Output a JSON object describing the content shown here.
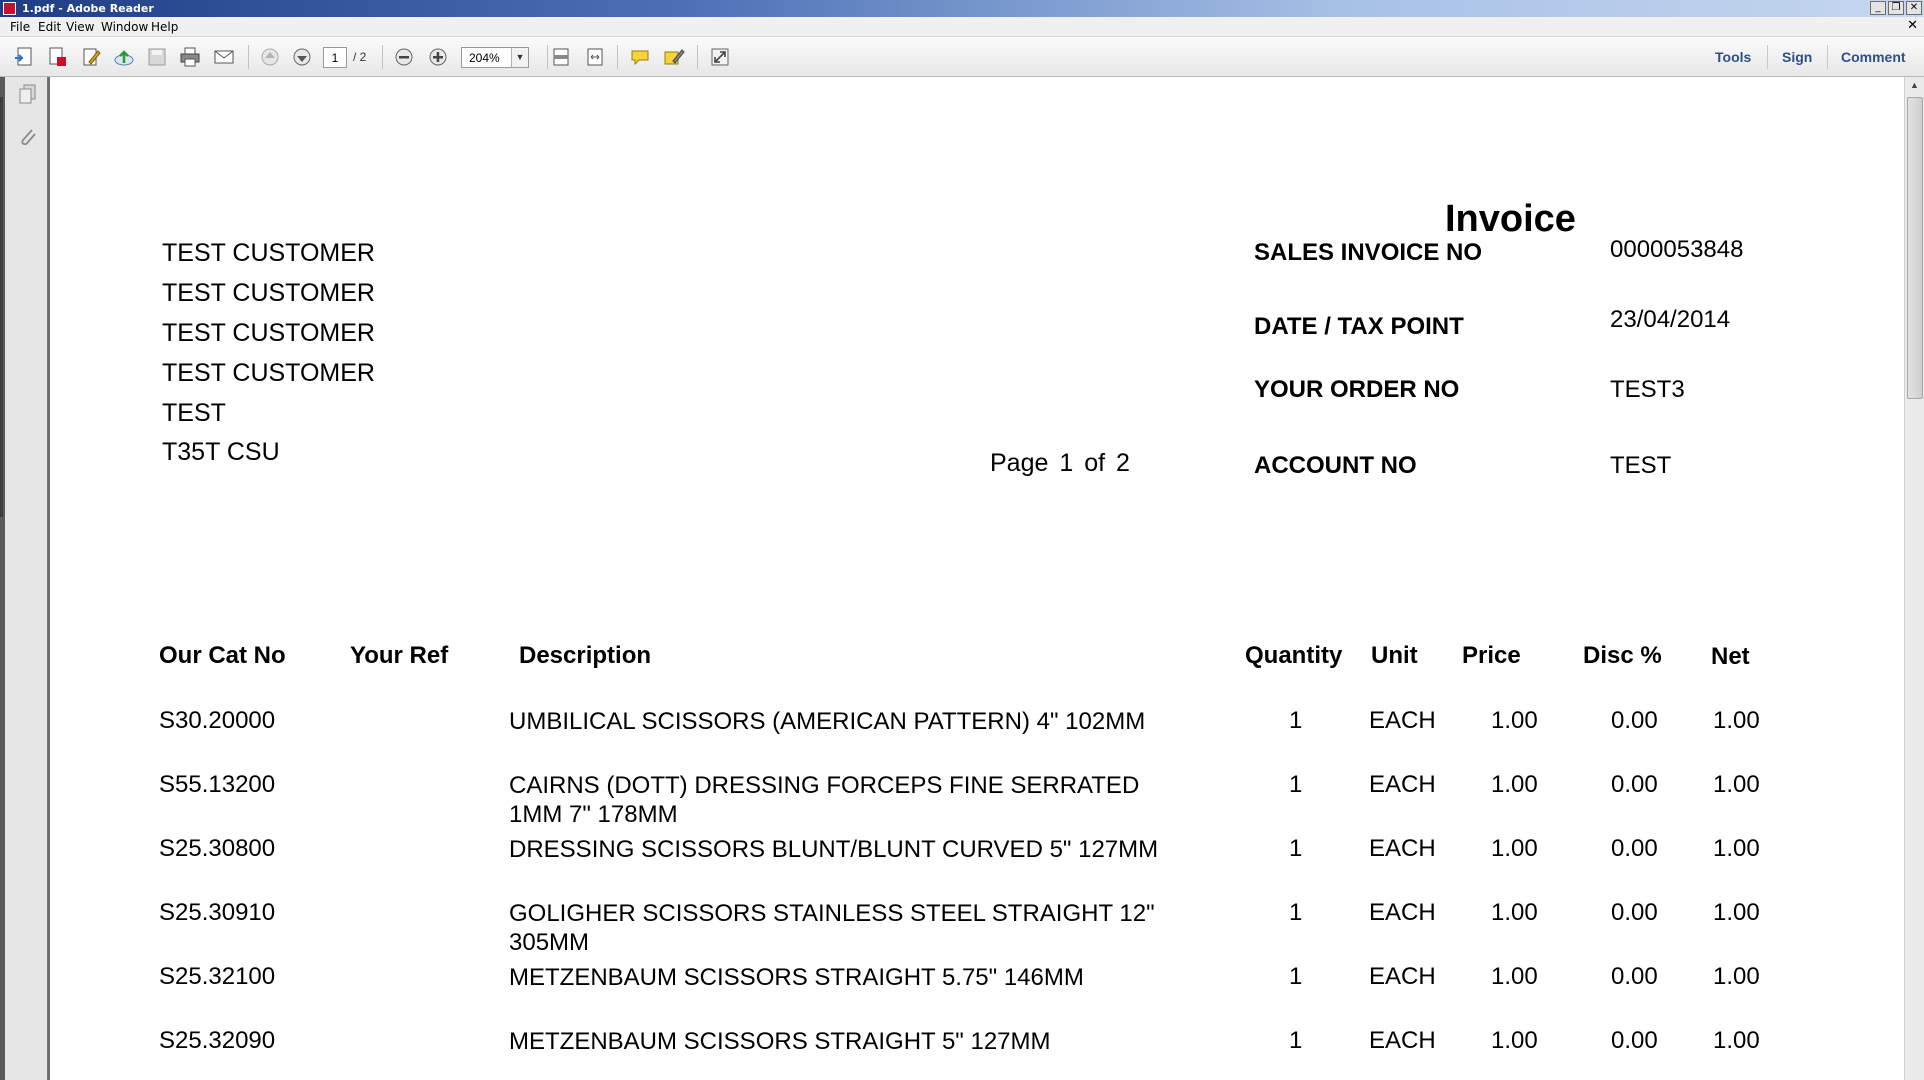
{
  "window": {
    "title": "1.pdf - Adobe Reader",
    "controls": {
      "minimize": "_",
      "restore": "❐",
      "close": "✕"
    },
    "doc_close": "✕"
  },
  "menu": [
    "File",
    "Edit",
    "View",
    "Window",
    "Help"
  ],
  "toolbar": {
    "icons": [
      "create-pdf-icon",
      "export-pdf-icon",
      "edit-pdf-icon",
      "upload-cloud-icon",
      "save-icon",
      "print-icon",
      "email-icon",
      "previous-page-icon",
      "next-page-icon",
      "zoom-out-icon",
      "zoom-in-icon",
      "fit-page-icon",
      "fit-width-icon",
      "comment-icon",
      "highlight-icon",
      "full-screen-icon"
    ],
    "page_current": "1",
    "page_total": "/ 2",
    "zoom": "204%",
    "zoom_dropdown": "▼",
    "tools": "Tools",
    "sign": "Sign",
    "comment": "Comment"
  },
  "nav_pane": {
    "icons": [
      "pages-icon",
      "attachments-icon"
    ]
  },
  "scrollbar": {
    "up_arrow": "▲",
    "position_fraction": 0.0
  },
  "invoice": {
    "title": "Invoice",
    "customer_lines": [
      "TEST CUSTOMER",
      "TEST CUSTOMER",
      "TEST CUSTOMER",
      "TEST CUSTOMER",
      "TEST",
      "T35T CSU"
    ],
    "page_info": {
      "page_label": "Page",
      "page": "1",
      "of_label": "of",
      "total": "2"
    },
    "fields": [
      {
        "label": "SALES INVOICE NO",
        "value": "0000053848"
      },
      {
        "label": "DATE / TAX POINT",
        "value": "23/04/2014"
      },
      {
        "label": "YOUR ORDER NO",
        "value": "TEST3"
      },
      {
        "label": "ACCOUNT NO",
        "value": "TEST"
      }
    ],
    "columns": [
      "Our Cat No",
      "Your Ref",
      "Description",
      "Quantity",
      "Unit",
      "Price",
      "Disc %",
      "Net"
    ],
    "rows": [
      {
        "cat": "S30.20000",
        "ref": "",
        "desc": "UMBILICAL SCISSORS (AMERICAN PATTERN) 4\" 102MM",
        "qty": "1",
        "unit": "EACH",
        "price": "1.00",
        "disc": "0.00",
        "net": "1.00"
      },
      {
        "cat": "S55.13200",
        "ref": "",
        "desc": "CAIRNS (DOTT) DRESSING FORCEPS FINE SERRATED 1MM 7\" 178MM",
        "qty": "1",
        "unit": "EACH",
        "price": "1.00",
        "disc": "0.00",
        "net": "1.00"
      },
      {
        "cat": "S25.30800",
        "ref": "",
        "desc": "DRESSING SCISSORS BLUNT/BLUNT CURVED 5\" 127MM",
        "qty": "1",
        "unit": "EACH",
        "price": "1.00",
        "disc": "0.00",
        "net": "1.00"
      },
      {
        "cat": "S25.30910",
        "ref": "",
        "desc": "GOLIGHER SCISSORS STAINLESS STEEL STRAIGHT 12\" 305MM",
        "qty": "1",
        "unit": "EACH",
        "price": "1.00",
        "disc": "0.00",
        "net": "1.00"
      },
      {
        "cat": "S25.32100",
        "ref": "",
        "desc": "METZENBAUM SCISSORS STRAIGHT 5.75\" 146MM",
        "qty": "1",
        "unit": "EACH",
        "price": "1.00",
        "disc": "0.00",
        "net": "1.00"
      },
      {
        "cat": "S25.32090",
        "ref": "",
        "desc": "METZENBAUM SCISSORS STRAIGHT 5\" 127MM",
        "qty": "1",
        "unit": "EACH",
        "price": "1.00",
        "disc": "0.00",
        "net": "1.00"
      }
    ]
  },
  "colors": {
    "title_bar": "#1f3d85",
    "toolbar_link": "#2f4f8a",
    "page_bg": "#ffffff",
    "viewer_bg": "#6d6d6d"
  }
}
